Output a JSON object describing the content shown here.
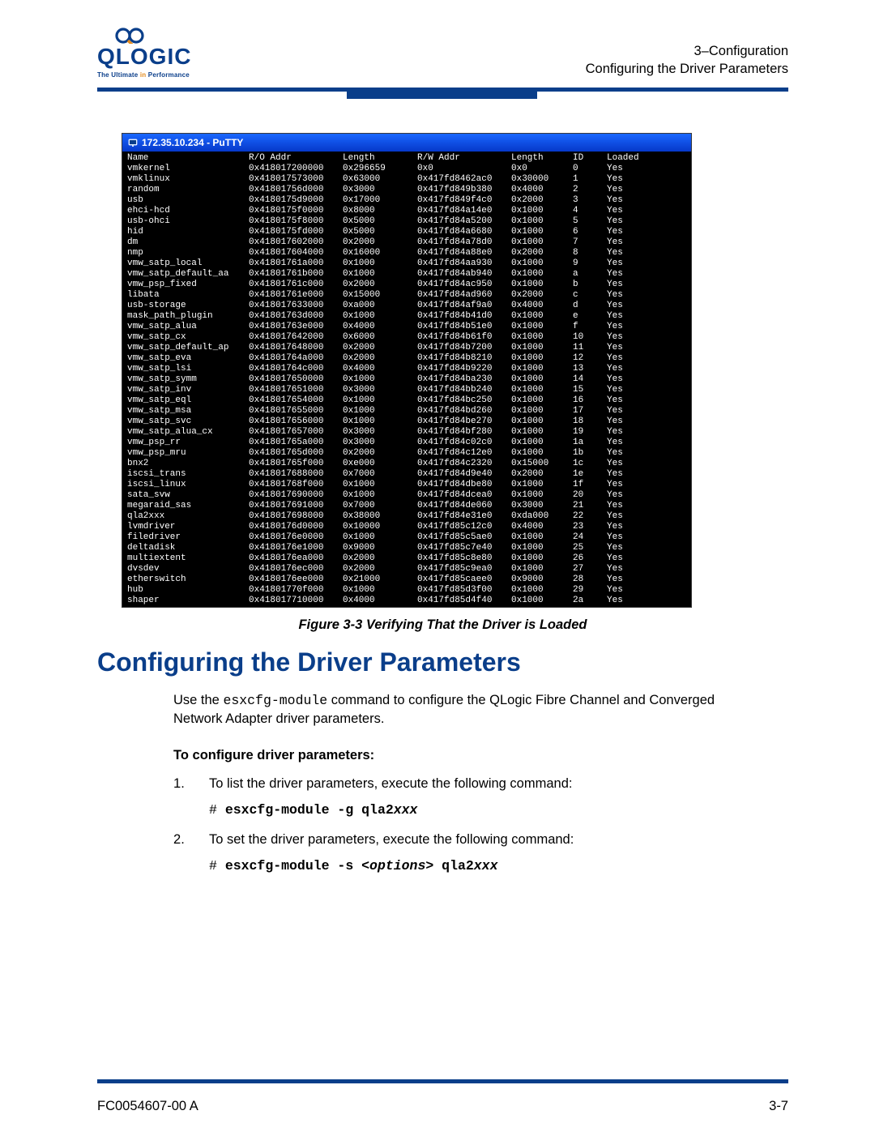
{
  "header": {
    "brand": "QLOGIC",
    "tagline_a": "The Ultimate ",
    "tagline_b": "in",
    "tagline_c": " Performance",
    "line1": "3–Configuration",
    "line2": "Configuring the Driver Parameters"
  },
  "terminal": {
    "title": "172.35.10.234 - PuTTY",
    "cols": [
      "Name",
      "R/O Addr",
      "Length",
      "R/W Addr",
      "Length",
      "ID",
      "Loaded"
    ],
    "rows": [
      [
        "vmkernel",
        "0x418017200000",
        "0x296659",
        "0x0",
        "0x0",
        "0",
        "Yes"
      ],
      [
        "vmklinux",
        "0x418017573000",
        "0x63000",
        "0x417fd8462ac0",
        "0x30000",
        "1",
        "Yes"
      ],
      [
        "random",
        "0x41801756d000",
        "0x3000",
        "0x417fd849b380",
        "0x4000",
        "2",
        "Yes"
      ],
      [
        "usb",
        "0x4180175d9000",
        "0x17000",
        "0x417fd849f4c0",
        "0x2000",
        "3",
        "Yes"
      ],
      [
        "ehci-hcd",
        "0x4180175f0000",
        "0x8000",
        "0x417fd84a14e0",
        "0x1000",
        "4",
        "Yes"
      ],
      [
        "usb-ohci",
        "0x4180175f8000",
        "0x5000",
        "0x417fd84a5200",
        "0x1000",
        "5",
        "Yes"
      ],
      [
        "hid",
        "0x4180175fd000",
        "0x5000",
        "0x417fd84a6680",
        "0x1000",
        "6",
        "Yes"
      ],
      [
        "dm",
        "0x418017602000",
        "0x2000",
        "0x417fd84a78d0",
        "0x1000",
        "7",
        "Yes"
      ],
      [
        "nmp",
        "0x418017604000",
        "0x16000",
        "0x417fd84a88e0",
        "0x2000",
        "8",
        "Yes"
      ],
      [
        "vmw_satp_local",
        "0x41801761a000",
        "0x1000",
        "0x417fd84aa930",
        "0x1000",
        "9",
        "Yes"
      ],
      [
        "vmw_satp_default_aa",
        "0x41801761b000",
        "0x1000",
        "0x417fd84ab940",
        "0x1000",
        "a",
        "Yes"
      ],
      [
        "vmw_psp_fixed",
        "0x41801761c000",
        "0x2000",
        "0x417fd84ac950",
        "0x1000",
        "b",
        "Yes"
      ],
      [
        "libata",
        "0x41801761e000",
        "0x15000",
        "0x417fd84ad960",
        "0x2000",
        "c",
        "Yes"
      ],
      [
        "usb-storage",
        "0x418017633000",
        "0xa000",
        "0x417fd84af9a0",
        "0x4000",
        "d",
        "Yes"
      ],
      [
        "mask_path_plugin",
        "0x41801763d000",
        "0x1000",
        "0x417fd84b41d0",
        "0x1000",
        "e",
        "Yes"
      ],
      [
        "vmw_satp_alua",
        "0x41801763e000",
        "0x4000",
        "0x417fd84b51e0",
        "0x1000",
        "f",
        "Yes"
      ],
      [
        "vmw_satp_cx",
        "0x418017642000",
        "0x6000",
        "0x417fd84b61f0",
        "0x1000",
        "10",
        "Yes"
      ],
      [
        "vmw_satp_default_ap",
        "0x418017648000",
        "0x2000",
        "0x417fd84b7200",
        "0x1000",
        "11",
        "Yes"
      ],
      [
        "vmw_satp_eva",
        "0x41801764a000",
        "0x2000",
        "0x417fd84b8210",
        "0x1000",
        "12",
        "Yes"
      ],
      [
        "vmw_satp_lsi",
        "0x41801764c000",
        "0x4000",
        "0x417fd84b9220",
        "0x1000",
        "13",
        "Yes"
      ],
      [
        "vmw_satp_symm",
        "0x418017650000",
        "0x1000",
        "0x417fd84ba230",
        "0x1000",
        "14",
        "Yes"
      ],
      [
        "vmw_satp_inv",
        "0x418017651000",
        "0x3000",
        "0x417fd84bb240",
        "0x1000",
        "15",
        "Yes"
      ],
      [
        "vmw_satp_eql",
        "0x418017654000",
        "0x1000",
        "0x417fd84bc250",
        "0x1000",
        "16",
        "Yes"
      ],
      [
        "vmw_satp_msa",
        "0x418017655000",
        "0x1000",
        "0x417fd84bd260",
        "0x1000",
        "17",
        "Yes"
      ],
      [
        "vmw_satp_svc",
        "0x418017656000",
        "0x1000",
        "0x417fd84be270",
        "0x1000",
        "18",
        "Yes"
      ],
      [
        "vmw_satp_alua_cx",
        "0x418017657000",
        "0x3000",
        "0x417fd84bf280",
        "0x1000",
        "19",
        "Yes"
      ],
      [
        "vmw_psp_rr",
        "0x41801765a000",
        "0x3000",
        "0x417fd84c02c0",
        "0x1000",
        "1a",
        "Yes"
      ],
      [
        "vmw_psp_mru",
        "0x41801765d000",
        "0x2000",
        "0x417fd84c12e0",
        "0x1000",
        "1b",
        "Yes"
      ],
      [
        "bnx2",
        "0x41801765f000",
        "0xe000",
        "0x417fd84c2320",
        "0x15000",
        "1c",
        "Yes"
      ],
      [
        "iscsi_trans",
        "0x418017688000",
        "0x7000",
        "0x417fd84d9e40",
        "0x2000",
        "1e",
        "Yes"
      ],
      [
        "iscsi_linux",
        "0x41801768f000",
        "0x1000",
        "0x417fd84dbe80",
        "0x1000",
        "1f",
        "Yes"
      ],
      [
        "sata_svw",
        "0x418017690000",
        "0x1000",
        "0x417fd84dcea0",
        "0x1000",
        "20",
        "Yes"
      ],
      [
        "megaraid_sas",
        "0x418017691000",
        "0x7000",
        "0x417fd84de060",
        "0x3000",
        "21",
        "Yes"
      ],
      [
        "qla2xxx",
        "0x418017698000",
        "0x38000",
        "0x417fd84e31e0",
        "0xda000",
        "22",
        "Yes"
      ],
      [
        "lvmdriver",
        "0x4180176d0000",
        "0x10000",
        "0x417fd85c12c0",
        "0x4000",
        "23",
        "Yes"
      ],
      [
        "filedriver",
        "0x4180176e0000",
        "0x1000",
        "0x417fd85c5ae0",
        "0x1000",
        "24",
        "Yes"
      ],
      [
        "deltadisk",
        "0x4180176e1000",
        "0x9000",
        "0x417fd85c7e40",
        "0x1000",
        "25",
        "Yes"
      ],
      [
        "multiextent",
        "0x4180176ea000",
        "0x2000",
        "0x417fd85c8e80",
        "0x1000",
        "26",
        "Yes"
      ],
      [
        "dvsdev",
        "0x4180176ec000",
        "0x2000",
        "0x417fd85c9ea0",
        "0x1000",
        "27",
        "Yes"
      ],
      [
        "etherswitch",
        "0x4180176ee000",
        "0x21000",
        "0x417fd85caee0",
        "0x9000",
        "28",
        "Yes"
      ],
      [
        "hub",
        "0x41801770f000",
        "0x1000",
        "0x417fd85d3f00",
        "0x1000",
        "29",
        "Yes"
      ],
      [
        "shaper",
        "0x418017710000",
        "0x4000",
        "0x417fd85d4f40",
        "0x1000",
        "2a",
        "Yes"
      ]
    ]
  },
  "fig_caption": "Figure 3-3  Verifying That the Driver is Loaded",
  "section_heading": "Configuring the Driver Parameters",
  "intro1a": "Use the ",
  "intro1_cmd": "esxcfg-module",
  "intro1b": " command to configure the QLogic Fibre Channel and Converged Network Adapter driver parameters.",
  "sub_heading": "To configure driver parameters:",
  "step1": "To list the driver parameters, execute the following command:",
  "step1_cmd": "esxcfg-module -g qla2",
  "step1_cmd_it": "xxx",
  "step2": "To set the driver parameters, execute the following command:",
  "step2_cmd_a": "esxcfg-module -s ",
  "step2_cmd_opt": "<options>",
  "step2_cmd_b": " qla2",
  "step2_cmd_it": "xxx",
  "footer_left": "FC0054607-00  A",
  "footer_right": "3-7"
}
